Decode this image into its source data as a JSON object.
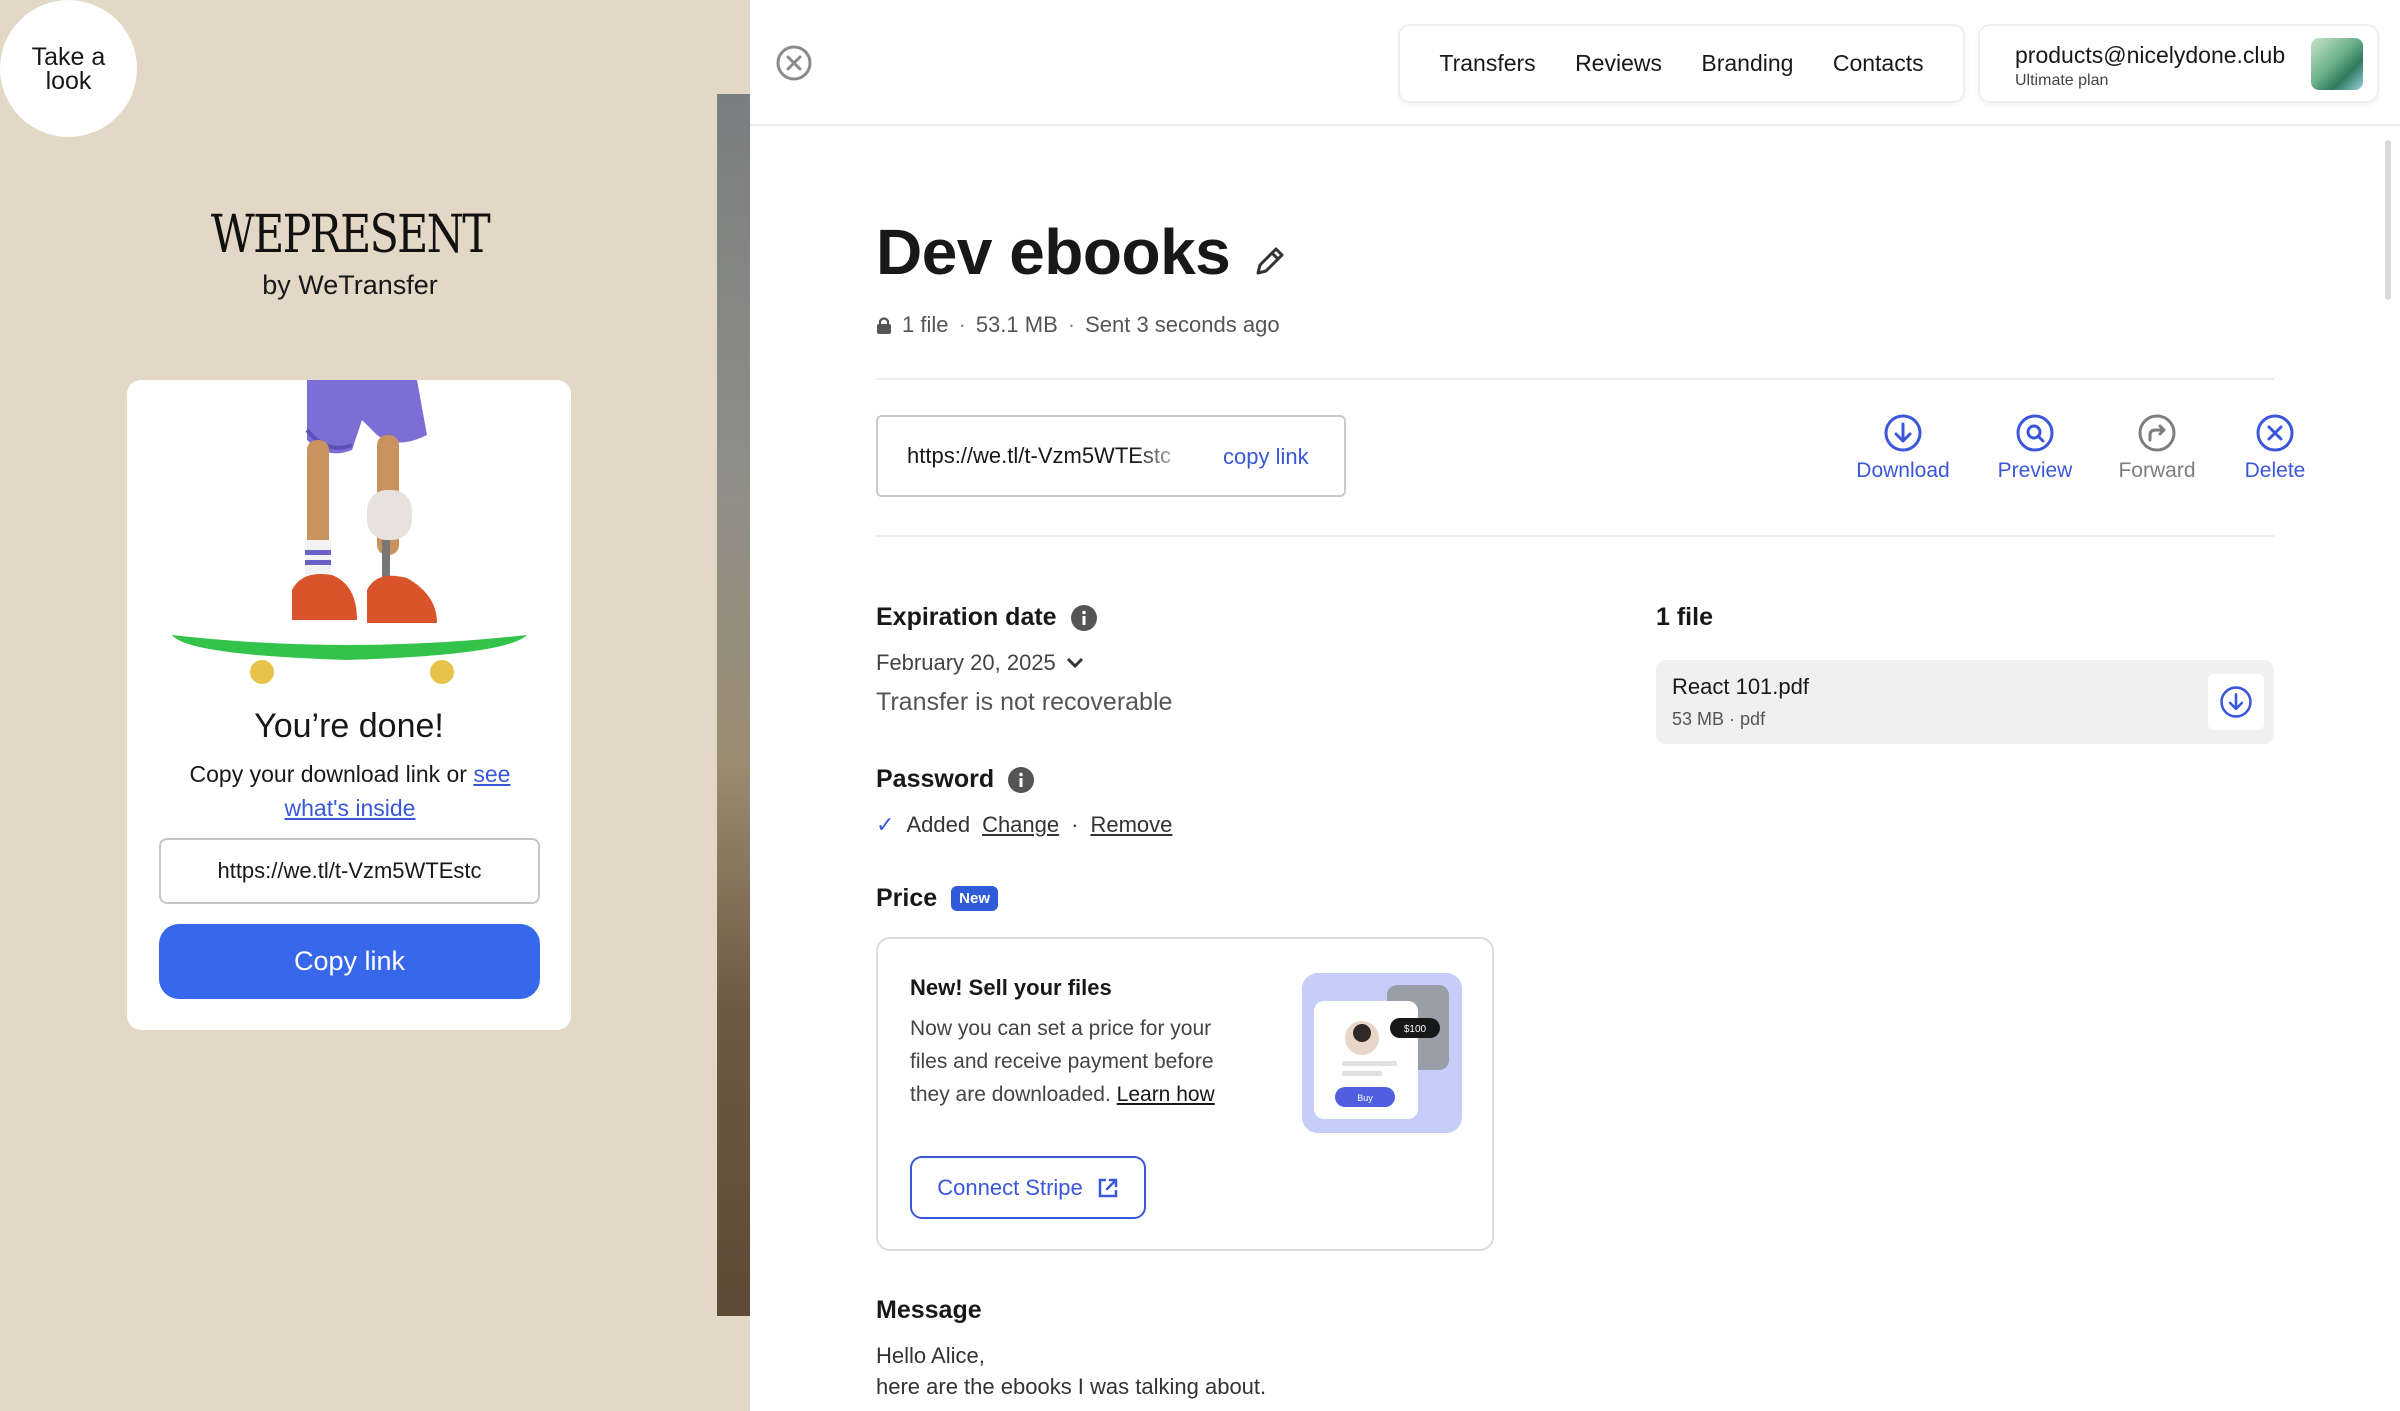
{
  "left": {
    "take_look": "Take a look",
    "brand_name": "WEPRESENT",
    "brand_sub": "by WeTransfer",
    "done_title": "You’re done!",
    "done_desc_prefix": "Copy your download link or ",
    "done_desc_link": "see what's inside",
    "link_value": "https://we.tl/t-Vzm5WTEstc",
    "copy_button": "Copy link"
  },
  "nav": {
    "items": [
      "Transfers",
      "Reviews",
      "Branding",
      "Contacts"
    ]
  },
  "account": {
    "email": "products@nicelydone.club",
    "plan": "Ultimate plan"
  },
  "transfer": {
    "title": "Dev ebooks",
    "file_count": "1 file",
    "size": "53.1 MB",
    "sent": "Sent 3 seconds ago",
    "link": "https://we.tl/t-Vzm5WTEstc",
    "copy_link": "copy link"
  },
  "actions": {
    "download": "Download",
    "preview": "Preview",
    "forward": "Forward",
    "delete": "Delete"
  },
  "expiration": {
    "heading": "Expiration date",
    "date": "February 20, 2025",
    "note": "Transfer is not recoverable"
  },
  "password": {
    "heading": "Password",
    "status": "Added",
    "change": "Change",
    "remove": "Remove"
  },
  "price": {
    "heading": "Price",
    "badge": "New",
    "card_title": "New! Sell your files",
    "card_desc": "Now you can set a price for your files and receive payment before they are downloaded.",
    "learn_how": "Learn how",
    "illus_price": "$100",
    "illus_buy": "Buy",
    "connect_button": "Connect Stripe"
  },
  "message": {
    "heading": "Message",
    "line1": "Hello Alice,",
    "line2": "here are the ebooks I was talking about."
  },
  "files": {
    "heading": "1 file",
    "items": [
      {
        "name": "React 101.pdf",
        "size": "53 MB",
        "type": "pdf"
      }
    ]
  },
  "colors": {
    "accent": "#3767ea",
    "link": "#3a57d9",
    "left_bg": "#e3d7c6"
  }
}
